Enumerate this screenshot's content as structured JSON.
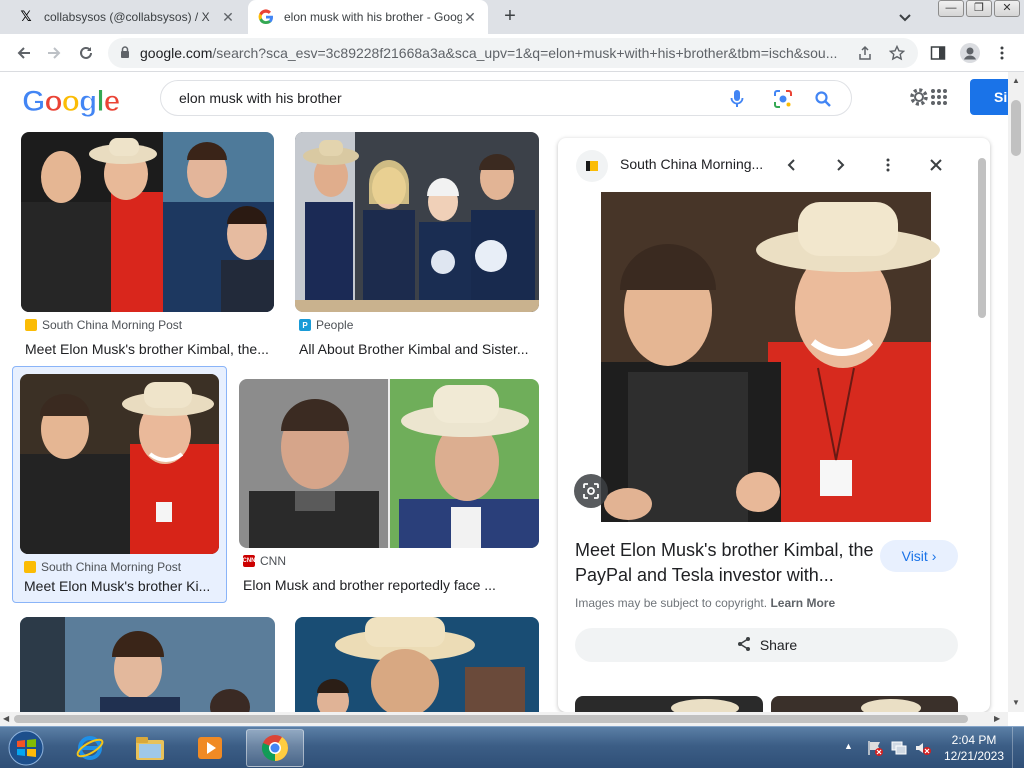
{
  "browser": {
    "tabs": [
      {
        "title": "collabsysos (@collabsysos) / X",
        "icon": "x-logo-icon"
      },
      {
        "title": "elon musk with his brother - Google",
        "icon": "google-g-icon"
      }
    ],
    "url_host": "google.com",
    "url_path": "/search?sca_esv=3c89228f21668a3a&sca_upv=1&q=elon+musk+with+his+brother&tbm=isch&sou..."
  },
  "google": {
    "logo_letters": [
      "G",
      "o",
      "o",
      "g",
      "l",
      "e"
    ],
    "logo_colors": [
      "#4285f4",
      "#ea4335",
      "#fbbc05",
      "#4285f4",
      "#34a853",
      "#ea4335"
    ],
    "query": "elon musk with his brother",
    "sign_in_label": "Si"
  },
  "results": [
    {
      "source": "South China Morning Post",
      "title": "Meet Elon Musk's brother Kimbal, the...",
      "source_color": "#fbbc05"
    },
    {
      "source": "People",
      "title": "All About Brother Kimbal and Sister...",
      "source_color": "#1a9bd7"
    },
    {
      "source": "South China Morning Post",
      "title": "Meet Elon Musk's brother Ki...",
      "source_color": "#fbbc05"
    },
    {
      "source": "CNN",
      "title": "Elon Musk and brother reportedly face ...",
      "source_color": "#cc0000"
    }
  ],
  "panel": {
    "source": "South China Morning...",
    "title": "Meet Elon Musk's brother Kimbal, the PayPal and Tesla investor with...",
    "visit_label": "Visit",
    "copyright": "Images may be subject to copyright.",
    "learn_more": "Learn More",
    "share_label": "Share"
  },
  "taskbar": {
    "time": "2:04 PM",
    "date": "12/21/2023"
  }
}
